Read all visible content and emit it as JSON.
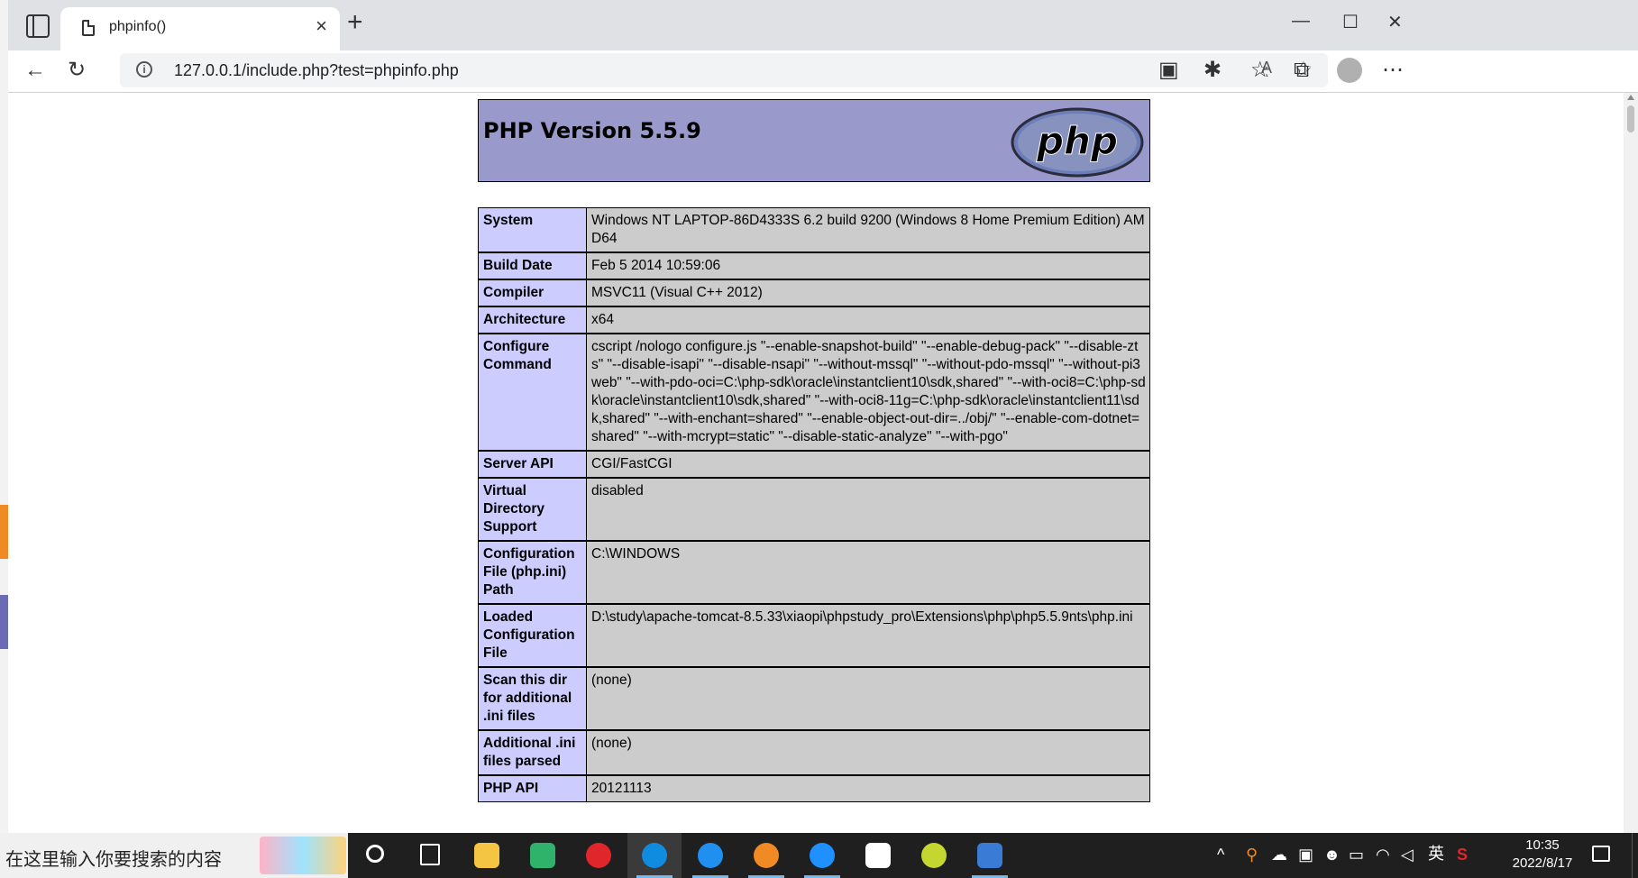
{
  "browser": {
    "tab_title": "phpinfo()",
    "tab_close": "×",
    "new_tab": "+",
    "url": "127.0.0.1/include.php?test=phpinfo.php",
    "info_glyph": "i",
    "read_aloud_glyph": "Aͅ",
    "window_controls": {
      "minimize": "—",
      "maximize": "☐",
      "close": "✕"
    },
    "toolbar_icons": {
      "back": "←",
      "refresh": "↻",
      "immersive_reader": "▣",
      "extensions": "✱",
      "favorites": "☆",
      "collections": "⧉",
      "more": "⋯",
      "favorite_add": "✩"
    }
  },
  "phpinfo": {
    "header_title": "PHP Version 5.5.9",
    "logo_text": "php",
    "rows": [
      {
        "key": "System",
        "value": "Windows NT LAPTOP-86D4333S 6.2 build 9200 (Windows 8 Home Premium Edition) AMD64"
      },
      {
        "key": "Build Date",
        "value": "Feb 5 2014 10:59:06"
      },
      {
        "key": "Compiler",
        "value": "MSVC11 (Visual C++ 2012)"
      },
      {
        "key": "Architecture",
        "value": "x64"
      },
      {
        "key": "Configure Command",
        "value": "cscript /nologo configure.js \"--enable-snapshot-build\" \"--enable-debug-pack\" \"--disable-zts\" \"--disable-isapi\" \"--disable-nsapi\" \"--without-mssql\" \"--without-pdo-mssql\" \"--without-pi3web\" \"--with-pdo-oci=C:\\php-sdk\\oracle\\instantclient10\\sdk,shared\" \"--with-oci8=C:\\php-sdk\\oracle\\instantclient10\\sdk,shared\" \"--with-oci8-11g=C:\\php-sdk\\oracle\\instantclient11\\sdk,shared\" \"--with-enchant=shared\" \"--enable-object-out-dir=../obj/\" \"--enable-com-dotnet=shared\" \"--with-mcrypt=static\" \"--disable-static-analyze\" \"--with-pgo\""
      },
      {
        "key": "Server API",
        "value": "CGI/FastCGI"
      },
      {
        "key": "Virtual Directory Support",
        "value": "disabled"
      },
      {
        "key": "Configuration File (php.ini) Path",
        "value": "C:\\WINDOWS"
      },
      {
        "key": "Loaded Configuration File",
        "value": "D:\\study\\apache-tomcat-8.5.33\\xiaopi\\phpstudy_pro\\Extensions\\php\\php5.5.9nts\\php.ini"
      },
      {
        "key": "Scan this dir for additional .ini files",
        "value": "(none)"
      },
      {
        "key": "Additional .ini files parsed",
        "value": "(none)"
      },
      {
        "key": "PHP API",
        "value": "20121113"
      }
    ]
  },
  "taskbar": {
    "search_placeholder": "在这里输入你要搜索的内容",
    "tray": {
      "chevron": "^",
      "language": "英",
      "time": "10:35",
      "date": "2022/8/17"
    },
    "app_colors": {
      "file_explorer": "#f4c542",
      "media_player": "#2fb36a",
      "netease_music": "#e0262a",
      "edge": "#0f8be0",
      "qq_browser": "#1f8ff0",
      "search_app": "#f08a24",
      "qq_browser2": "#1e90ff",
      "typora": "#ffffff",
      "qq_game": "#c5d631",
      "app_window": "#3a7bd5"
    }
  }
}
